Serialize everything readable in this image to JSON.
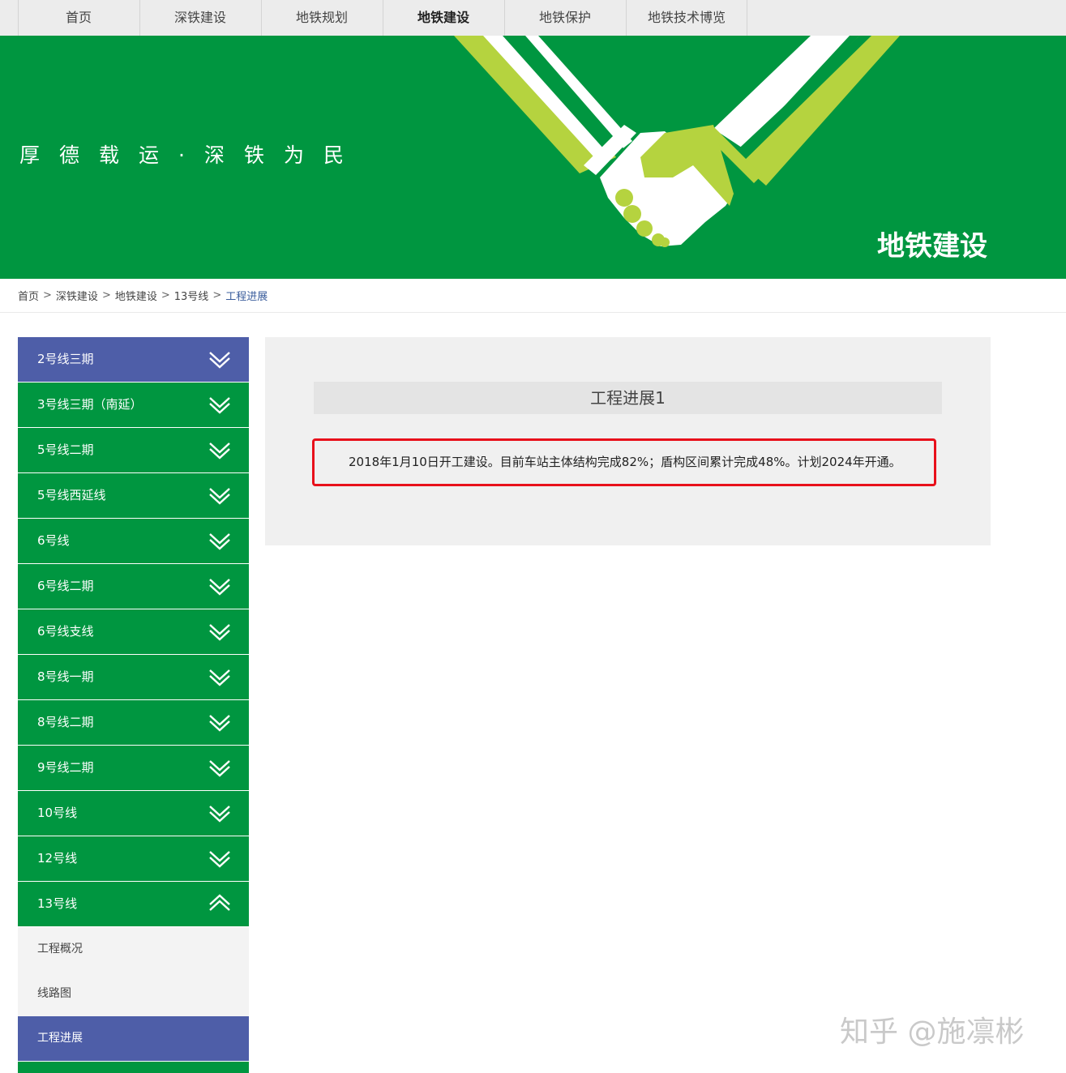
{
  "top_nav": {
    "items": [
      {
        "label": "首页"
      },
      {
        "label": "深铁建设"
      },
      {
        "label": "地铁规划"
      },
      {
        "label": "地铁建设"
      },
      {
        "label": "地铁保护"
      },
      {
        "label": "地铁技术博览"
      }
    ],
    "active_label": "地铁建设"
  },
  "banner": {
    "slogan": "厚德载运·深铁为民",
    "title": "地铁建设",
    "background": "#009640",
    "accent": "#b5d33f",
    "icon": "handshake-graphic"
  },
  "breadcrumb": {
    "items": [
      "首页",
      "深铁建设",
      "地铁建设",
      "13号线"
    ],
    "current": "工程进展",
    "separator": ">"
  },
  "sidebar": {
    "items": [
      {
        "label": "2号线三期"
      },
      {
        "label": "3号线三期（南延）"
      },
      {
        "label": "5号线二期"
      },
      {
        "label": "5号线西延线"
      },
      {
        "label": "6号线"
      },
      {
        "label": "6号线二期"
      },
      {
        "label": "6号线支线"
      },
      {
        "label": "8号线一期"
      },
      {
        "label": "8号线二期"
      },
      {
        "label": "9号线二期"
      },
      {
        "label": "10号线"
      },
      {
        "label": "12号线"
      },
      {
        "label": "13号线"
      }
    ],
    "sub_items": [
      {
        "label": "工程概况"
      },
      {
        "label": "线路图"
      },
      {
        "label": "工程进展"
      }
    ],
    "colors": {
      "green": "#009640",
      "blue": "#4e5ea8"
    },
    "icons": {
      "collapsed": "chevron-down-icon",
      "expanded": "chevron-up-icon"
    }
  },
  "content": {
    "title": "工程进展1",
    "description": "2018年1月10日开工建设。目前车站主体结构完成82%；盾构区间累计完成48%。计划2024年开通。",
    "highlight_color": "#e8101b"
  },
  "watermark": {
    "text": "知乎 @施凛彬"
  }
}
